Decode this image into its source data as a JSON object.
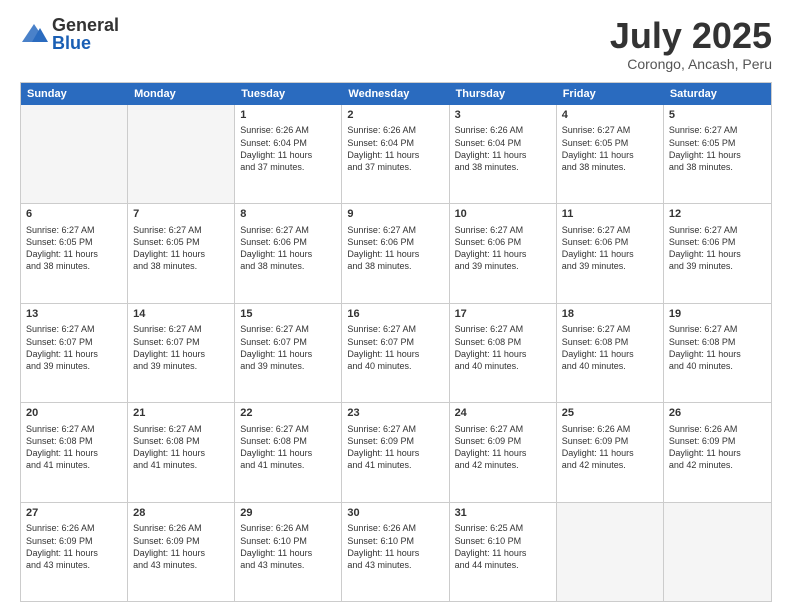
{
  "logo": {
    "general": "General",
    "blue": "Blue"
  },
  "title": "July 2025",
  "location": "Corongo, Ancash, Peru",
  "weekdays": [
    "Sunday",
    "Monday",
    "Tuesday",
    "Wednesday",
    "Thursday",
    "Friday",
    "Saturday"
  ],
  "rows": [
    [
      {
        "day": "",
        "lines": [],
        "empty": true
      },
      {
        "day": "",
        "lines": [],
        "empty": true
      },
      {
        "day": "1",
        "lines": [
          "Sunrise: 6:26 AM",
          "Sunset: 6:04 PM",
          "Daylight: 11 hours",
          "and 37 minutes."
        ]
      },
      {
        "day": "2",
        "lines": [
          "Sunrise: 6:26 AM",
          "Sunset: 6:04 PM",
          "Daylight: 11 hours",
          "and 37 minutes."
        ]
      },
      {
        "day": "3",
        "lines": [
          "Sunrise: 6:26 AM",
          "Sunset: 6:04 PM",
          "Daylight: 11 hours",
          "and 38 minutes."
        ]
      },
      {
        "day": "4",
        "lines": [
          "Sunrise: 6:27 AM",
          "Sunset: 6:05 PM",
          "Daylight: 11 hours",
          "and 38 minutes."
        ]
      },
      {
        "day": "5",
        "lines": [
          "Sunrise: 6:27 AM",
          "Sunset: 6:05 PM",
          "Daylight: 11 hours",
          "and 38 minutes."
        ]
      }
    ],
    [
      {
        "day": "6",
        "lines": [
          "Sunrise: 6:27 AM",
          "Sunset: 6:05 PM",
          "Daylight: 11 hours",
          "and 38 minutes."
        ]
      },
      {
        "day": "7",
        "lines": [
          "Sunrise: 6:27 AM",
          "Sunset: 6:05 PM",
          "Daylight: 11 hours",
          "and 38 minutes."
        ]
      },
      {
        "day": "8",
        "lines": [
          "Sunrise: 6:27 AM",
          "Sunset: 6:06 PM",
          "Daylight: 11 hours",
          "and 38 minutes."
        ]
      },
      {
        "day": "9",
        "lines": [
          "Sunrise: 6:27 AM",
          "Sunset: 6:06 PM",
          "Daylight: 11 hours",
          "and 38 minutes."
        ]
      },
      {
        "day": "10",
        "lines": [
          "Sunrise: 6:27 AM",
          "Sunset: 6:06 PM",
          "Daylight: 11 hours",
          "and 39 minutes."
        ]
      },
      {
        "day": "11",
        "lines": [
          "Sunrise: 6:27 AM",
          "Sunset: 6:06 PM",
          "Daylight: 11 hours",
          "and 39 minutes."
        ]
      },
      {
        "day": "12",
        "lines": [
          "Sunrise: 6:27 AM",
          "Sunset: 6:06 PM",
          "Daylight: 11 hours",
          "and 39 minutes."
        ]
      }
    ],
    [
      {
        "day": "13",
        "lines": [
          "Sunrise: 6:27 AM",
          "Sunset: 6:07 PM",
          "Daylight: 11 hours",
          "and 39 minutes."
        ]
      },
      {
        "day": "14",
        "lines": [
          "Sunrise: 6:27 AM",
          "Sunset: 6:07 PM",
          "Daylight: 11 hours",
          "and 39 minutes."
        ]
      },
      {
        "day": "15",
        "lines": [
          "Sunrise: 6:27 AM",
          "Sunset: 6:07 PM",
          "Daylight: 11 hours",
          "and 39 minutes."
        ]
      },
      {
        "day": "16",
        "lines": [
          "Sunrise: 6:27 AM",
          "Sunset: 6:07 PM",
          "Daylight: 11 hours",
          "and 40 minutes."
        ]
      },
      {
        "day": "17",
        "lines": [
          "Sunrise: 6:27 AM",
          "Sunset: 6:08 PM",
          "Daylight: 11 hours",
          "and 40 minutes."
        ]
      },
      {
        "day": "18",
        "lines": [
          "Sunrise: 6:27 AM",
          "Sunset: 6:08 PM",
          "Daylight: 11 hours",
          "and 40 minutes."
        ]
      },
      {
        "day": "19",
        "lines": [
          "Sunrise: 6:27 AM",
          "Sunset: 6:08 PM",
          "Daylight: 11 hours",
          "and 40 minutes."
        ]
      }
    ],
    [
      {
        "day": "20",
        "lines": [
          "Sunrise: 6:27 AM",
          "Sunset: 6:08 PM",
          "Daylight: 11 hours",
          "and 41 minutes."
        ]
      },
      {
        "day": "21",
        "lines": [
          "Sunrise: 6:27 AM",
          "Sunset: 6:08 PM",
          "Daylight: 11 hours",
          "and 41 minutes."
        ]
      },
      {
        "day": "22",
        "lines": [
          "Sunrise: 6:27 AM",
          "Sunset: 6:08 PM",
          "Daylight: 11 hours",
          "and 41 minutes."
        ]
      },
      {
        "day": "23",
        "lines": [
          "Sunrise: 6:27 AM",
          "Sunset: 6:09 PM",
          "Daylight: 11 hours",
          "and 41 minutes."
        ]
      },
      {
        "day": "24",
        "lines": [
          "Sunrise: 6:27 AM",
          "Sunset: 6:09 PM",
          "Daylight: 11 hours",
          "and 42 minutes."
        ]
      },
      {
        "day": "25",
        "lines": [
          "Sunrise: 6:26 AM",
          "Sunset: 6:09 PM",
          "Daylight: 11 hours",
          "and 42 minutes."
        ]
      },
      {
        "day": "26",
        "lines": [
          "Sunrise: 6:26 AM",
          "Sunset: 6:09 PM",
          "Daylight: 11 hours",
          "and 42 minutes."
        ]
      }
    ],
    [
      {
        "day": "27",
        "lines": [
          "Sunrise: 6:26 AM",
          "Sunset: 6:09 PM",
          "Daylight: 11 hours",
          "and 43 minutes."
        ]
      },
      {
        "day": "28",
        "lines": [
          "Sunrise: 6:26 AM",
          "Sunset: 6:09 PM",
          "Daylight: 11 hours",
          "and 43 minutes."
        ]
      },
      {
        "day": "29",
        "lines": [
          "Sunrise: 6:26 AM",
          "Sunset: 6:10 PM",
          "Daylight: 11 hours",
          "and 43 minutes."
        ]
      },
      {
        "day": "30",
        "lines": [
          "Sunrise: 6:26 AM",
          "Sunset: 6:10 PM",
          "Daylight: 11 hours",
          "and 43 minutes."
        ]
      },
      {
        "day": "31",
        "lines": [
          "Sunrise: 6:25 AM",
          "Sunset: 6:10 PM",
          "Daylight: 11 hours",
          "and 44 minutes."
        ]
      },
      {
        "day": "",
        "lines": [],
        "empty": true
      },
      {
        "day": "",
        "lines": [],
        "empty": true
      }
    ]
  ]
}
